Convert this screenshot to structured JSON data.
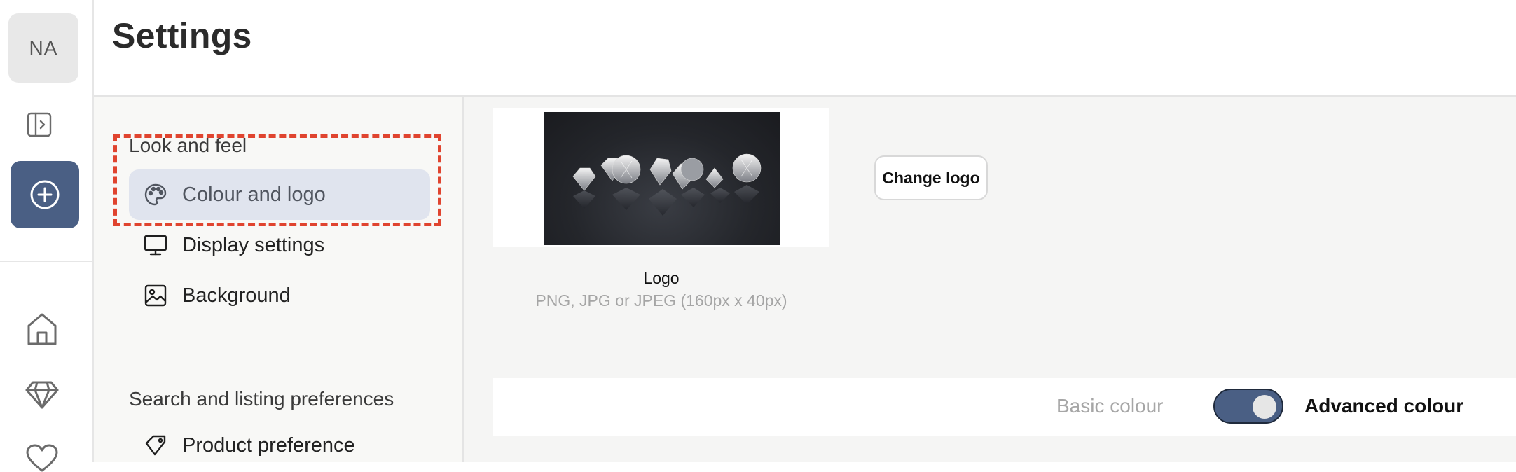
{
  "rail": {
    "avatar_initials": "NA",
    "icons": [
      "sidebar-expand-icon",
      "plus-circle-icon",
      "home-icon",
      "diamond-icon",
      "heart-icon"
    ],
    "accent_color": "#4a5f84"
  },
  "header": {
    "title": "Settings"
  },
  "nav": {
    "groups": [
      {
        "title": "Look and feel",
        "items": [
          {
            "label": "Colour and logo",
            "icon": "palette-icon",
            "active": true
          },
          {
            "label": "Display settings",
            "icon": "monitor-icon",
            "active": false
          },
          {
            "label": "Background",
            "icon": "image-icon",
            "active": false
          }
        ]
      },
      {
        "title": "Search and listing preferences",
        "items": [
          {
            "label": "Product preference",
            "icon": "tag-icon",
            "active": false
          }
        ]
      }
    ],
    "highlight_color": "#e0442f"
  },
  "logo": {
    "caption": "Logo",
    "hint": "PNG, JPG or JPEG (160px x 40px)",
    "change_label": "Change logo"
  },
  "colour_mode": {
    "basic_label": "Basic colour",
    "advanced_label": "Advanced colour",
    "advanced_enabled": true
  }
}
